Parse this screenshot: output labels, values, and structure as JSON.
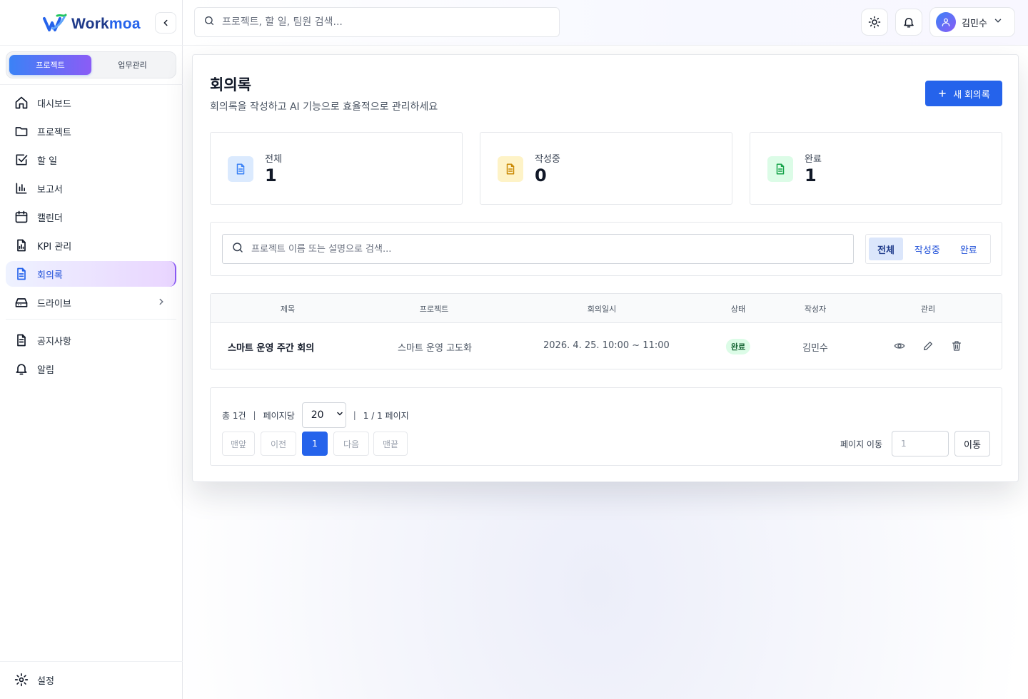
{
  "app": {
    "logo_work": "Work",
    "logo_moa": "moa"
  },
  "sidebar": {
    "modes": [
      "프로젝트",
      "업무관리"
    ],
    "items": [
      {
        "label": "대시보드",
        "icon": "home-icon"
      },
      {
        "label": "프로젝트",
        "icon": "folder-icon"
      },
      {
        "label": "할 일",
        "icon": "checkbox-icon"
      },
      {
        "label": "보고서",
        "icon": "bar-chart-icon"
      },
      {
        "label": "캘린더",
        "icon": "calendar-icon"
      },
      {
        "label": "KPI 관리",
        "icon": "file-chart-icon"
      },
      {
        "label": "회의록",
        "icon": "document-icon",
        "active": true
      },
      {
        "label": "드라이브",
        "icon": "hard-drive-icon"
      }
    ],
    "secondary": [
      {
        "label": "공지사항",
        "icon": "notice-icon"
      },
      {
        "label": "알림",
        "icon": "bell-icon"
      }
    ],
    "settings": "설정"
  },
  "header": {
    "search_placeholder": "프로젝트, 할 일, 팀원 검색...",
    "user_name": "김민수"
  },
  "page": {
    "title": "회의록",
    "description": "회의록을 작성하고 AI 기능으로 효율적으로 관리하세요",
    "new_button": "새 회의록"
  },
  "stats": [
    {
      "label": "전체",
      "value": "1",
      "color": "#3b82f6",
      "bg": "#dbeafe"
    },
    {
      "label": "작성중",
      "value": "0",
      "color": "#ca8a04",
      "bg": "#fef3c7"
    },
    {
      "label": "완료",
      "value": "1",
      "color": "#16a34a",
      "bg": "#dcfce7"
    }
  ],
  "filter": {
    "search_placeholder": "프로젝트 이름 또는 설명으로 검색...",
    "tabs": [
      "전체",
      "작성중",
      "완료"
    ],
    "active_tab": "전체"
  },
  "table": {
    "columns": [
      "제목",
      "프로젝트",
      "회의일시",
      "상태",
      "작성자",
      "관리"
    ],
    "rows": [
      {
        "title": "스마트 운영 주간 회의",
        "project": "스마트 운영 고도화",
        "datetime": "2026. 4. 25. 10:00 ~ 11:00",
        "status": "완료",
        "author": "김민수"
      }
    ]
  },
  "pagination": {
    "total": "총 1건",
    "per_page_label": "페이지당",
    "per_page": "20",
    "page_info": "1 / 1 페이지",
    "first": "맨앞",
    "prev": "이전",
    "current": "1",
    "next": "다음",
    "last": "맨끝",
    "jump_label": "페이지 이동",
    "jump_placeholder": "1",
    "jump_button": "이동"
  }
}
